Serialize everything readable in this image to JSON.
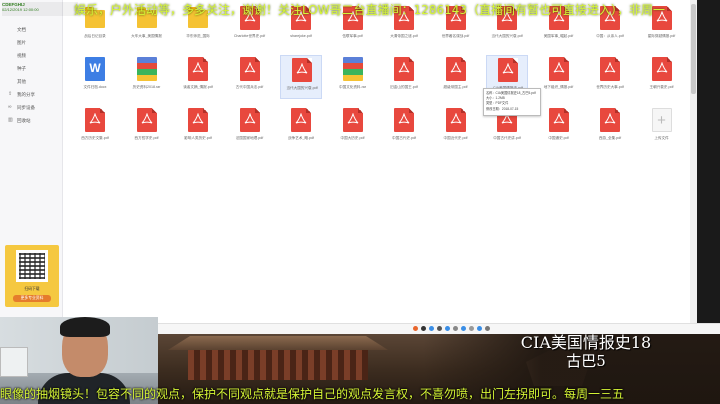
{
  "stream": {
    "tag_line1": "CDEFGHIJ",
    "tag_line2": "02/12/2019 12:00:00",
    "banner_text": "娱乐，户外活动等，多多关注，谢谢！关注LOW哥二台直播间：1286143（直播间有暂也可直接进入），非周一",
    "ticker_text": "眼像的抽烟镜头！包容不同的观点，保护不同观点就是保护自己的观点发言权，不喜勿喷，出门左拐即可。每周一三五"
  },
  "video": {
    "title": "CIA美国情报史18",
    "subtitle": "古巴5"
  },
  "sidebar": {
    "items": [
      {
        "icon": "",
        "label": "文档"
      },
      {
        "icon": "",
        "label": "图片"
      },
      {
        "icon": "",
        "label": "视频"
      },
      {
        "icon": "",
        "label": "种子"
      },
      {
        "icon": "",
        "label": "其他"
      },
      {
        "icon": "share-icon",
        "label": "我的分享"
      },
      {
        "icon": "link-icon",
        "label": "同步设备"
      },
      {
        "icon": "trash-icon",
        "label": "回收站"
      }
    ],
    "promo": {
      "line1": "扫码下载",
      "button": "更多专业资料"
    }
  },
  "tooltip": {
    "lines": [
      "名称：CIA美国情报史18_古巴5.pdf",
      "大小：1.2MB",
      "类型：PDF文件",
      "修改日期：2018-07-15"
    ]
  },
  "files": {
    "row1": [
      {
        "type": "folder",
        "name": "战后日记目录"
      },
      {
        "type": "folder",
        "name": "大车大事_美国情报"
      },
      {
        "type": "folder",
        "name": "华东师范_国际"
      },
      {
        "type": "pdf",
        "name": "Charlotte世界史.pdf"
      },
      {
        "type": "pdf",
        "name": "sharejoke.pdf"
      },
      {
        "type": "pdf",
        "name": "伍联军事.pdf"
      },
      {
        "type": "pdf",
        "name": "大清帝国之谜.pdf"
      },
      {
        "type": "pdf",
        "name": "世界著名谍战.pdf"
      },
      {
        "type": "pdf",
        "name": "当代大国的兴衰.pdf"
      },
      {
        "type": "pdf",
        "name": "美国军事_崛起.pdf"
      },
      {
        "type": "pdf",
        "name": "中国：从亲人.pdf"
      },
      {
        "type": "pdf",
        "name": "星际穿越情报.pdf"
      }
    ],
    "row2": [
      {
        "type": "word",
        "name": "文件归档.docx"
      },
      {
        "type": "rar",
        "name": "历史资料2018.rar"
      },
      {
        "type": "pdf",
        "name": "读者文摘_情报.pdf"
      },
      {
        "type": "pdf",
        "name": "古代中国兵法.pdf"
      },
      {
        "type": "pdf",
        "name": "当代大国的兴衰.pdf"
      },
      {
        "type": "rar",
        "name": "中国文化资料.rar"
      },
      {
        "type": "pdf",
        "name": "旧金山的国王.pdf"
      },
      {
        "type": "pdf",
        "name": "超级帝国主.pdf"
      },
      {
        "type": "pdf",
        "name": "CIA美国情报史.pdf"
      },
      {
        "type": "pdf",
        "name": "地下组织_情报.pdf"
      },
      {
        "type": "pdf",
        "name": "世界历史大事.pdf"
      },
      {
        "type": "pdf",
        "name": "王朝兴衰史.pdf"
      }
    ],
    "row3": [
      {
        "type": "pdf",
        "name": "西方历史文集.pdf"
      },
      {
        "type": "pdf",
        "name": "西方哲学史.pdf"
      },
      {
        "type": "pdf",
        "name": "影响人类历史.pdf"
      },
      {
        "type": "pdf",
        "name": "法国国家地理.pdf"
      },
      {
        "type": "pdf",
        "name": "战争艺术_略.pdf"
      },
      {
        "type": "pdf",
        "name": "中国大历史.pdf"
      },
      {
        "type": "pdf",
        "name": "中国古代史.pdf"
      },
      {
        "type": "pdf",
        "name": "中国近代史.pdf"
      },
      {
        "type": "pdf",
        "name": "中国古代史讲.pdf"
      },
      {
        "type": "pdf",
        "name": "中国通史.pdf"
      },
      {
        "type": "pdf",
        "name": "西游_全集.pdf"
      },
      {
        "type": "add",
        "name": "上传文件"
      }
    ]
  }
}
